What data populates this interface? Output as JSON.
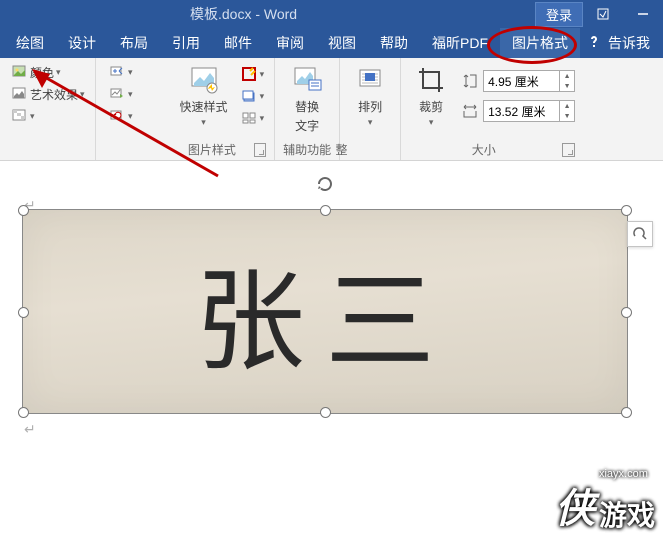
{
  "title": "模板.docx - Word",
  "login_label": "登录",
  "tabs": [
    "绘图",
    "设计",
    "布局",
    "引用",
    "邮件",
    "审阅",
    "视图",
    "帮助",
    "福昕PDF",
    "图片格式"
  ],
  "tell_me": "告诉我",
  "adjust": {
    "color": "颜色",
    "artistic": "艺术效果",
    "group_label": "整"
  },
  "styles": {
    "quick_styles": "快速样式",
    "group_label": "图片样式"
  },
  "accessibility": {
    "alt_text_line1": "替换",
    "alt_text_line2": "文字",
    "group_label": "辅助功能"
  },
  "arrange": {
    "label": "排列"
  },
  "size": {
    "crop": "裁剪",
    "height": "4.95 厘米",
    "width": "13.52 厘米",
    "group_label": "大小"
  },
  "handwriting": "张三",
  "watermark": {
    "logo": "侠",
    "text": "游戏",
    "url": "xiayx.com"
  }
}
